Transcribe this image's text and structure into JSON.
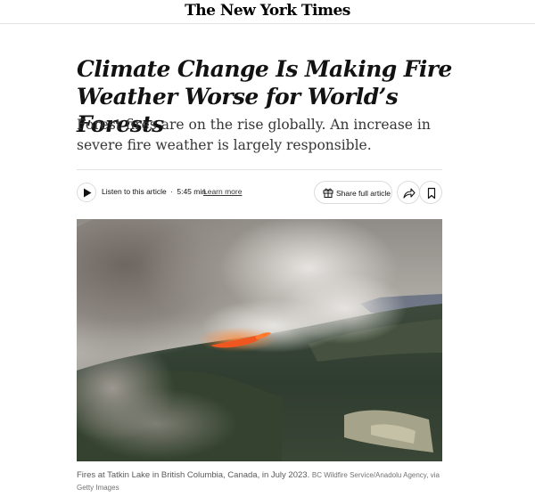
{
  "masthead": {
    "logo_text": "The New York Times"
  },
  "article": {
    "headline": "Climate Change Is Making Fire Weather Worse for World’s Forests",
    "dek": "Forest fires are on the rise globally. An increase in severe fire weather is largely responsible."
  },
  "toolbar": {
    "listen_label": "Listen to this article",
    "listen_separator": "·",
    "listen_duration": "5:45 min",
    "learn_more": "Learn more",
    "share_full_label": "Share full article",
    "play_icon": "play-icon",
    "gift_icon": "gift-icon",
    "share_icon": "share-arrow-icon",
    "bookmark_icon": "bookmark-icon"
  },
  "hero": {
    "caption": "Fires at Tatkin Lake in British Columbia, Canada, in July 2023.",
    "credit": "BC Wildfire Service/Anadolu Agency, via Getty Images"
  },
  "colors": {
    "text": "#121212",
    "rule": "#e2e2e2",
    "flame": "#f0561f",
    "forest": "#2b3a2c",
    "smoke": "#a9a7a2"
  }
}
